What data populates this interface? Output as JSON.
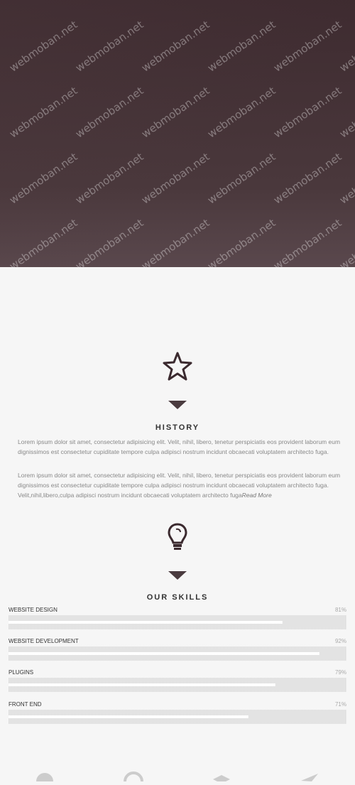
{
  "watermark": "webmoban.net",
  "history": {
    "icon": "star-icon",
    "title": "HISTORY",
    "paragraph1": "Lorem ipsum dolor sit amet, consectetur adipisicing elit. Velit, nihil, libero, tenetur perspiciatis eos provident laborum eum dignissimos est consectetur cupiditate tempore culpa adipisci nostrum incidunt obcaecati voluptatem architecto fuga.",
    "paragraph2": "Lorem ipsum dolor sit amet, consectetur adipisicing elit. Velit, nihil, libero, tenetur perspiciatis eos provident laborum eum dignissimos est consectetur cupiditate tempore culpa adipisci nostrum incidunt obcaecati voluptatem architecto fuga. Velit,nihil,libero,culpa adipisci nostrum incidunt obcaecati voluptatem architecto fuga",
    "read_more": "Read More"
  },
  "skills": {
    "icon": "lightbulb-icon",
    "title": "OUR SKILLS",
    "items": [
      {
        "label": "WEBSITE DESIGN",
        "percent": "81%",
        "value": 81
      },
      {
        "label": "WEBSITE DEVELOPMENT",
        "percent": "92%",
        "value": 92
      },
      {
        "label": "PLUGINS",
        "percent": "79%",
        "value": 79
      },
      {
        "label": "FRONT END",
        "percent": "71%",
        "value": 71
      }
    ]
  },
  "colors": {
    "hero": "#3e2b30",
    "accent": "#4a3b3f"
  },
  "bottom_icons": [
    "palette-icon",
    "support-icon",
    "graduation-cap-icon",
    "paper-plane-icon"
  ]
}
